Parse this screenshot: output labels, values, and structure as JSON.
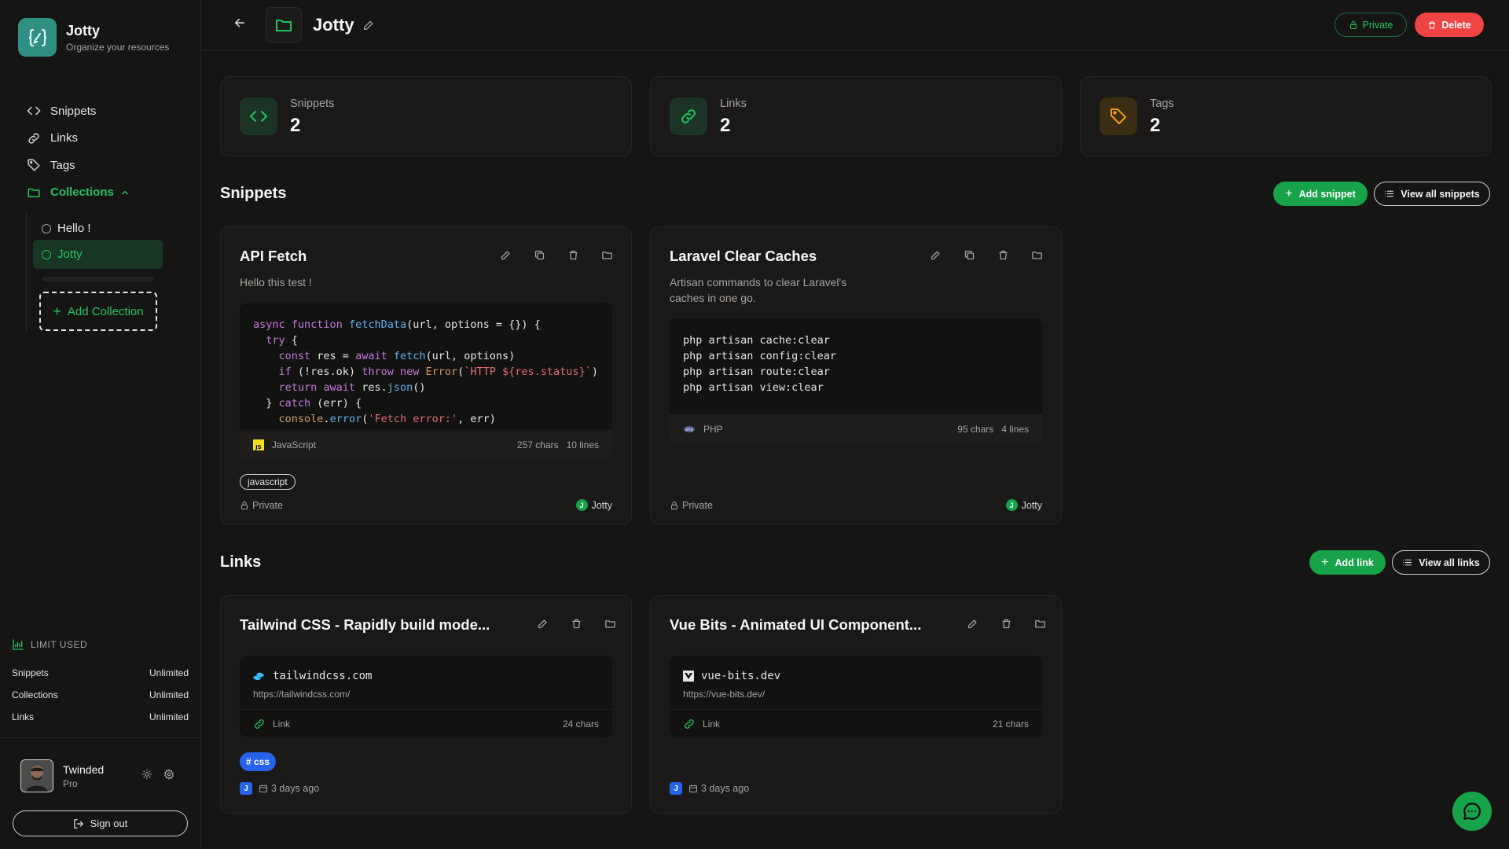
{
  "brand": {
    "name": "Jotty",
    "subtitle": "Organize your resources"
  },
  "nav": {
    "items": [
      {
        "label": "Snippets"
      },
      {
        "label": "Links"
      },
      {
        "label": "Tags"
      },
      {
        "label": "Collections"
      }
    ]
  },
  "collections": {
    "items": [
      {
        "label": "Hello !"
      },
      {
        "label": "Jotty"
      }
    ],
    "add_label": "Add Collection"
  },
  "limits": {
    "title": "LIMIT USED",
    "rows": [
      {
        "label": "Snippets",
        "value": "Unlimited"
      },
      {
        "label": "Collections",
        "value": "Unlimited"
      },
      {
        "label": "Links",
        "value": "Unlimited"
      }
    ]
  },
  "user": {
    "name": "Twinded",
    "plan": "Pro",
    "signout": "Sign out"
  },
  "header": {
    "title": "Jotty",
    "private_label": "Private",
    "delete_label": "Delete"
  },
  "stats": [
    {
      "label": "Snippets",
      "value": "2"
    },
    {
      "label": "Links",
      "value": "2"
    },
    {
      "label": "Tags",
      "value": "2"
    }
  ],
  "snippets_section": {
    "title": "Snippets",
    "add_label": "Add snippet",
    "view_all_label": "View all snippets"
  },
  "snippets": [
    {
      "title": "API Fetch",
      "description": "Hello this test !",
      "language": "JavaScript",
      "chars": "257 chars",
      "lines": "10 lines",
      "tag": "javascript",
      "visibility": "Private",
      "owner": "Jotty",
      "owner_initial": "J"
    },
    {
      "title": "Laravel Clear Caches",
      "description": "Artisan commands to clear Laravel's caches in one go.",
      "language": "PHP",
      "chars": "95 chars",
      "lines": "4 lines",
      "visibility": "Private",
      "owner": "Jotty",
      "owner_initial": "J",
      "code": [
        "php artisan cache:clear",
        "php artisan config:clear",
        "php artisan route:clear",
        "php artisan view:clear"
      ]
    }
  ],
  "links_section": {
    "title": "Links",
    "add_label": "Add link",
    "view_all_label": "View all links"
  },
  "links": [
    {
      "title": "Tailwind CSS - Rapidly build mode...",
      "domain": "tailwindcss.com",
      "url": "https://tailwindcss.com/",
      "type": "Link",
      "chars": "24 chars",
      "tag": "# css",
      "date": "3 days ago",
      "owner_initial": "J"
    },
    {
      "title": "Vue Bits - Animated UI Component...",
      "domain": "vue-bits.dev",
      "url": "https://vue-bits.dev/",
      "type": "Link",
      "chars": "21 chars",
      "date": "3 days ago",
      "owner_initial": "J"
    }
  ],
  "colors": {
    "accent": "#22c55e",
    "danger": "#ef4444",
    "tag_blue": "#2563eb",
    "background": "#151514"
  }
}
